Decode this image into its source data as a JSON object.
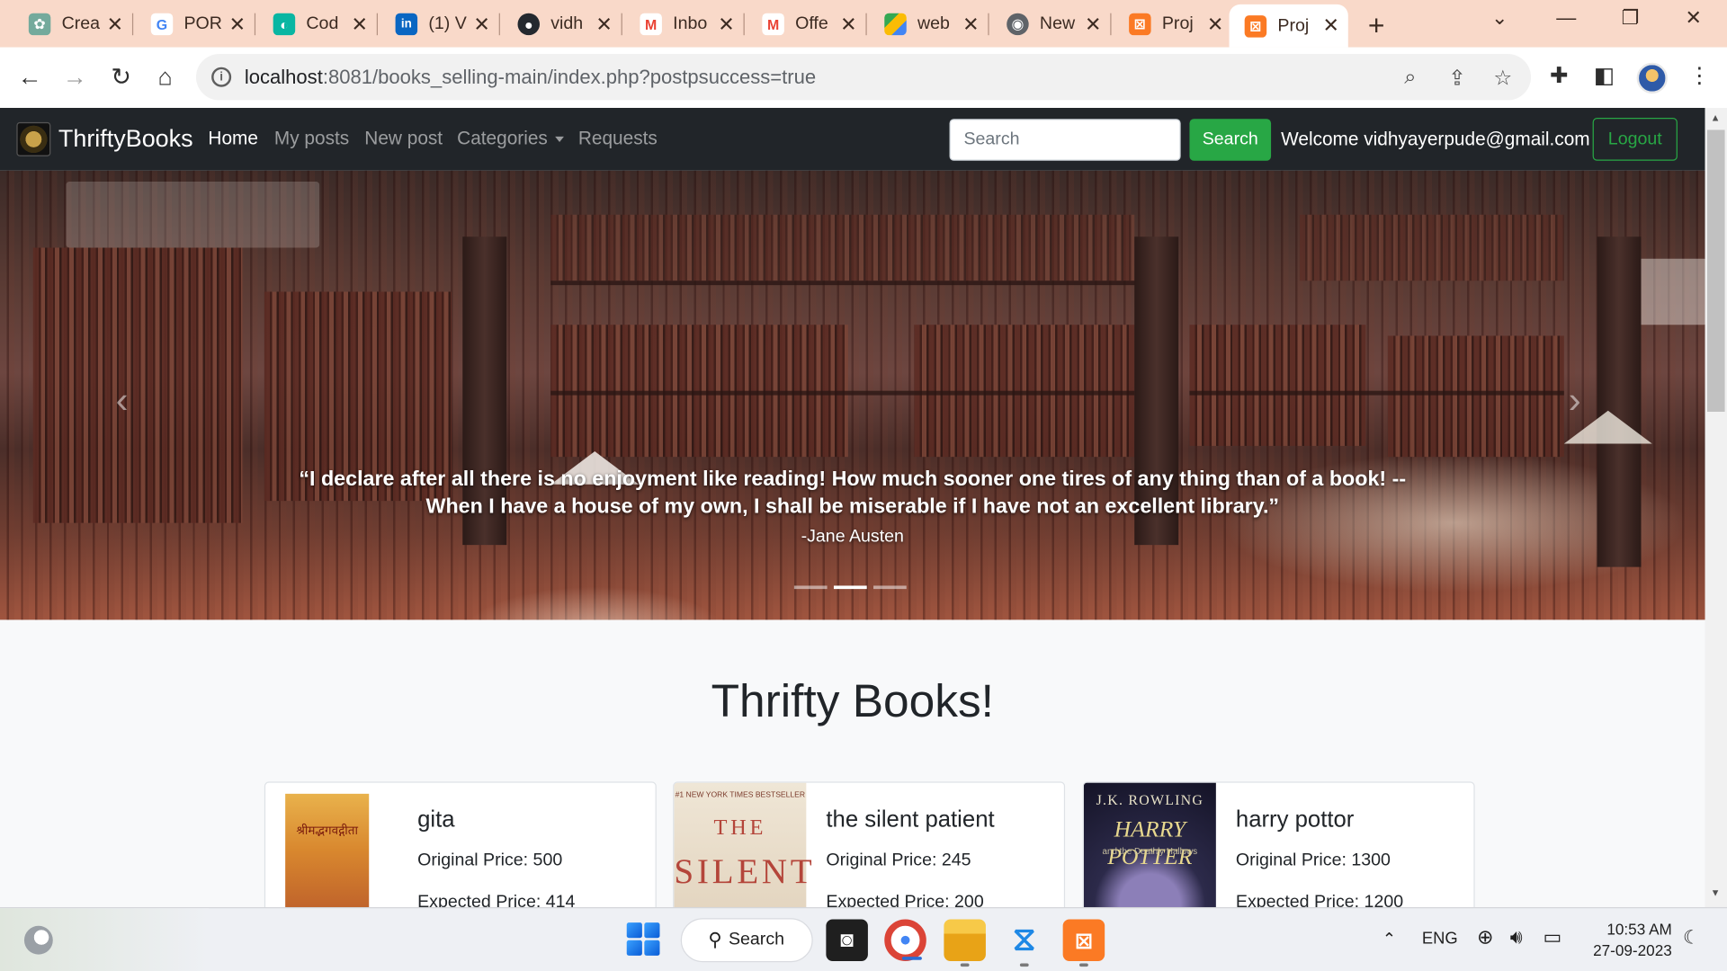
{
  "browser": {
    "tabs": [
      {
        "title": "Crea",
        "icon": "chatgpt-icon",
        "color": "#74aa9c"
      },
      {
        "title": "POR",
        "icon": "google-icon",
        "color": "#4285f4"
      },
      {
        "title": "Cod",
        "icon": "codeium-icon",
        "color": "#09b6a2"
      },
      {
        "title": "(1) V",
        "icon": "linkedin-icon",
        "color": "#0a66c2"
      },
      {
        "title": "vidh",
        "icon": "github-icon",
        "color": "#24292f"
      },
      {
        "title": "Inbo",
        "icon": "gmail-icon",
        "color": "#ea4335"
      },
      {
        "title": "Offe",
        "icon": "gmail-icon",
        "color": "#ea4335"
      },
      {
        "title": "web",
        "icon": "google-drive-icon",
        "color": "#34a853"
      },
      {
        "title": "New",
        "icon": "chrome-icon",
        "color": "#5f6368"
      },
      {
        "title": "Proj",
        "icon": "xampp-icon",
        "color": "#fb7a24"
      },
      {
        "title": "Proj",
        "icon": "xampp-icon",
        "color": "#fb7a24",
        "active": true
      }
    ],
    "url_host": "localhost",
    "url_rest": ":8081/books_selling-main/index.php?postpsuccess=true"
  },
  "site": {
    "brand": "ThriftyBooks",
    "nav": {
      "home": "Home",
      "my_posts": "My posts",
      "new_post": "New post",
      "categories": "Categories",
      "requests": "Requests"
    },
    "search_placeholder": "Search",
    "search_button": "Search",
    "welcome": "Welcome vidhyayerpude@gmail.com",
    "logout": "Logout"
  },
  "carousel": {
    "quote_line1": "“I declare after all there is no enjoyment like reading! How much sooner one tires of any thing than of a book! --",
    "quote_line2": "When I have a house of my own, I shall be miserable if I have not an excellent library.”",
    "author": "-Jane Austen",
    "slide_count": 3,
    "active_slide": 2
  },
  "main": {
    "heading": "Thrifty Books!",
    "books": [
      {
        "name": "gita",
        "original_price": "Original Price: 500",
        "expected_price": "Expected Price: 414",
        "cover_text": "श्रीमद्भगवद्गीता"
      },
      {
        "name": "the silent patient",
        "original_price": "Original Price: 245",
        "expected_price": "Expected Price: 200",
        "cover_top": "#1 NEW YORK TIMES BESTSELLER",
        "cover_the": "THE",
        "cover_title": "SILENT"
      },
      {
        "name": "harry pottor",
        "original_price": "Original Price: 1300",
        "expected_price": "Expected Price: 1200",
        "cover_author": "J.K. ROWLING",
        "cover_title": "HARRY POTTER",
        "cover_sub": "and the Deathly Hallows"
      }
    ]
  },
  "taskbar": {
    "search_label": "Search",
    "language": "ENG",
    "time": "10:53 AM",
    "date": "27-09-2023"
  }
}
